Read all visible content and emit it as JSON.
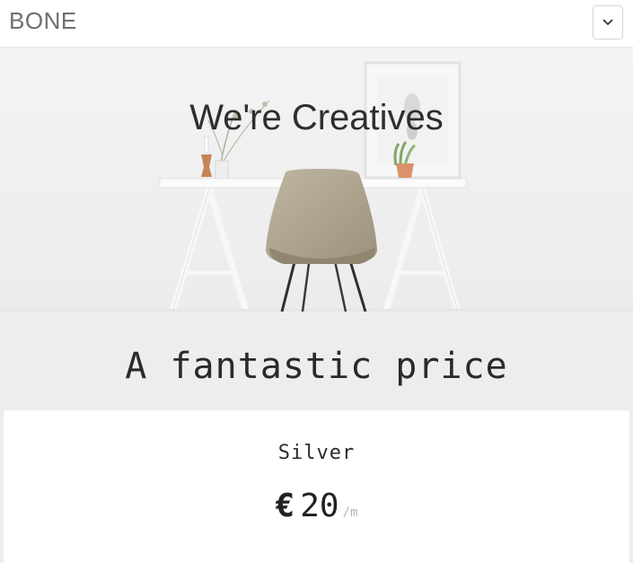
{
  "navbar": {
    "brand": "BONE",
    "toggle_icon": "chevron-down-icon"
  },
  "hero": {
    "title": "We're Creatives",
    "image": "desk-chair-photo"
  },
  "pricing": {
    "section_title": "A fantastic price",
    "plan": {
      "name": "Silver",
      "currency": "€",
      "amount": "20",
      "period": "/m"
    }
  },
  "colors": {
    "navbar_bg": "#ffffff",
    "page_bg": "#ededed",
    "card_bg": "#ffffff",
    "text_dark": "#2a2a2a",
    "brand_text": "#6f6f6f"
  }
}
